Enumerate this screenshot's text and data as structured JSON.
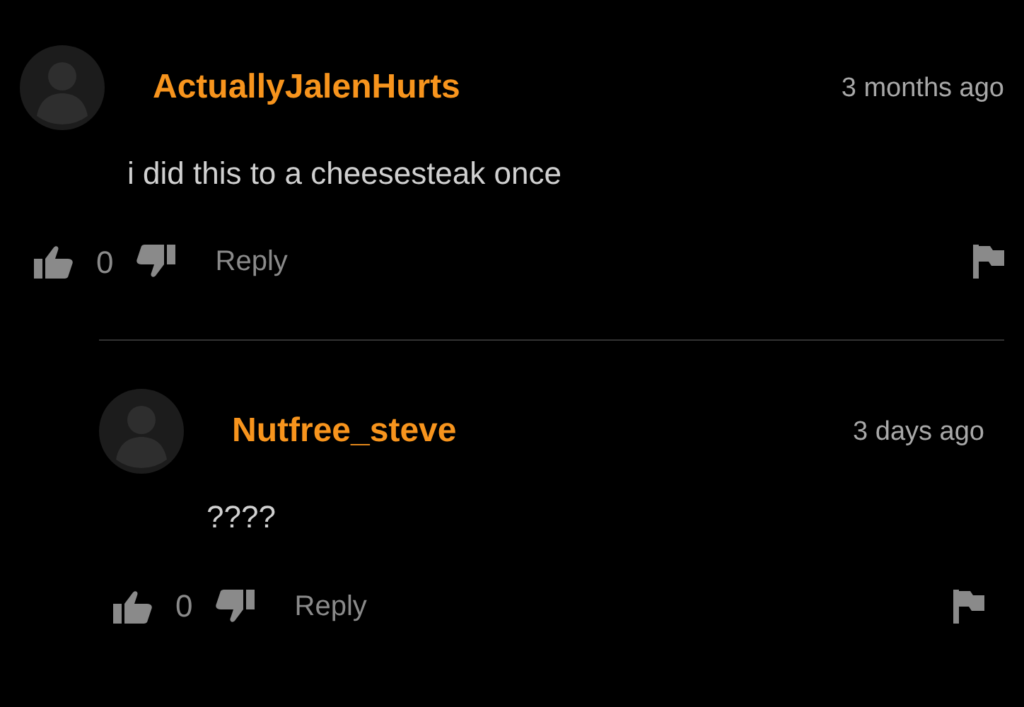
{
  "comments": [
    {
      "username": "ActuallyJalenHurts",
      "time": "3 months ago",
      "text": "i did this to a cheesesteak once",
      "likes": "0",
      "reply": "Reply",
      "children": [
        {
          "username": "Nutfree_steve",
          "time": "3 days ago",
          "text": "????",
          "likes": "0",
          "reply": "Reply"
        }
      ]
    }
  ]
}
